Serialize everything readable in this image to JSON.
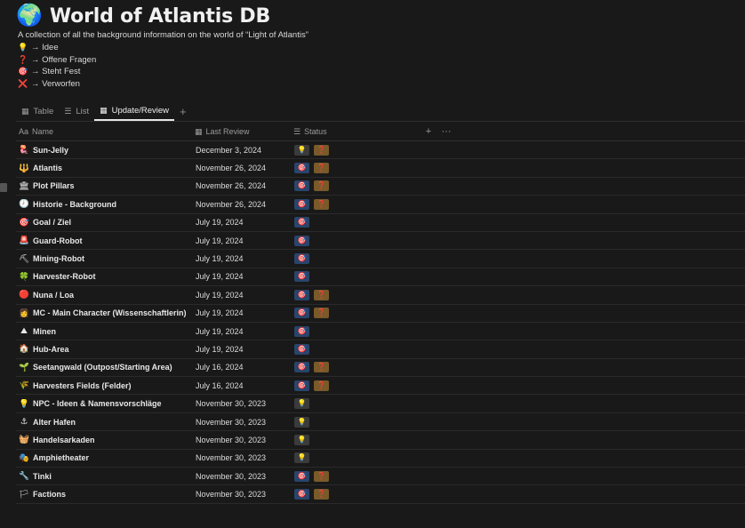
{
  "page": {
    "icon": "🌍",
    "title": "World of Atlantis DB",
    "description": "A collection of all the background information on the world of “Light of Atlantis”"
  },
  "legend": [
    {
      "icon": "💡",
      "label": "→ Idee"
    },
    {
      "icon": "❓",
      "label": "→ Offene Fragen"
    },
    {
      "icon": "🎯",
      "label": "→ Steht Fest"
    },
    {
      "icon": "❌",
      "label": "→ Verworfen"
    }
  ],
  "tabs": [
    {
      "icon": "▦",
      "label": "Table",
      "active": false
    },
    {
      "icon": "☰",
      "label": "List",
      "active": false
    },
    {
      "icon": "▦",
      "label": "Update/Review",
      "active": true
    }
  ],
  "add_view": "+",
  "columns": {
    "name": {
      "icon": "Aa",
      "label": "Name"
    },
    "review": {
      "icon": "▦",
      "label": "Last Review"
    },
    "status": {
      "icon": "☰",
      "label": "Status"
    },
    "add": "+",
    "more": "···"
  },
  "status_icons": {
    "idee": "💡",
    "offen": "❓",
    "steht": "🎯",
    "verworfen": "❌"
  },
  "rows": [
    {
      "icon": "🪼",
      "name": "Sun-Jelly",
      "date": "December 3, 2024",
      "status": [
        "idee",
        "offen"
      ]
    },
    {
      "icon": "🔱",
      "name": "Atlantis",
      "date": "November 26, 2024",
      "status": [
        "steht",
        "offen"
      ]
    },
    {
      "icon": "🏛",
      "name": "Plot Pillars",
      "date": "November 26, 2024",
      "status": [
        "steht",
        "offen"
      ]
    },
    {
      "icon": "🕗",
      "name": "Historie - Background",
      "date": "November 26, 2024",
      "status": [
        "steht",
        "offen"
      ]
    },
    {
      "icon": "🎯",
      "name": "Goal / Ziel",
      "date": "July 19, 2024",
      "status": [
        "steht"
      ]
    },
    {
      "icon": "🚨",
      "name": "Guard-Robot",
      "date": "July 19, 2024",
      "status": [
        "steht"
      ]
    },
    {
      "icon": "⛏",
      "name": "Mining-Robot",
      "date": "July 19, 2024",
      "status": [
        "steht"
      ]
    },
    {
      "icon": "🍀",
      "name": "Harvester-Robot",
      "date": "July 19, 2024",
      "status": [
        "steht"
      ]
    },
    {
      "icon": "🔴",
      "name": "Nuna / Loa",
      "date": "July 19, 2024",
      "status": [
        "steht",
        "offen"
      ]
    },
    {
      "icon": "👩",
      "name": "MC - Main Character (Wissenschaftlerin)",
      "date": "July 19, 2024",
      "status": [
        "steht",
        "offen"
      ]
    },
    {
      "icon": "⛰",
      "name": "Minen",
      "date": "July 19, 2024",
      "status": [
        "steht"
      ]
    },
    {
      "icon": "🏠",
      "name": "Hub-Area",
      "date": "July 19, 2024",
      "status": [
        "steht"
      ]
    },
    {
      "icon": "🌱",
      "name": "Seetangwald (Outpost/Starting Area)",
      "date": "July 16, 2024",
      "status": [
        "steht",
        "offen"
      ]
    },
    {
      "icon": "🌾",
      "name": "Harvesters Fields (Felder)",
      "date": "July 16, 2024",
      "status": [
        "steht",
        "offen"
      ]
    },
    {
      "icon": "💡",
      "name": "NPC - Ideen & Namensvorschläge",
      "date": "November 30, 2023",
      "status": [
        "idee"
      ]
    },
    {
      "icon": "⚓",
      "name": "Alter Hafen",
      "date": "November 30, 2023",
      "status": [
        "idee"
      ]
    },
    {
      "icon": "🧺",
      "name": "Handelsarkaden",
      "date": "November 30, 2023",
      "status": [
        "idee"
      ]
    },
    {
      "icon": "🎭",
      "name": "Amphietheater",
      "date": "November 30, 2023",
      "status": [
        "idee"
      ]
    },
    {
      "icon": "🔧",
      "name": "Tinki",
      "date": "November 30, 2023",
      "status": [
        "steht",
        "offen"
      ]
    },
    {
      "icon": "🏳",
      "name": "Factions",
      "date": "November 30, 2023",
      "status": [
        "steht",
        "offen"
      ]
    }
  ]
}
